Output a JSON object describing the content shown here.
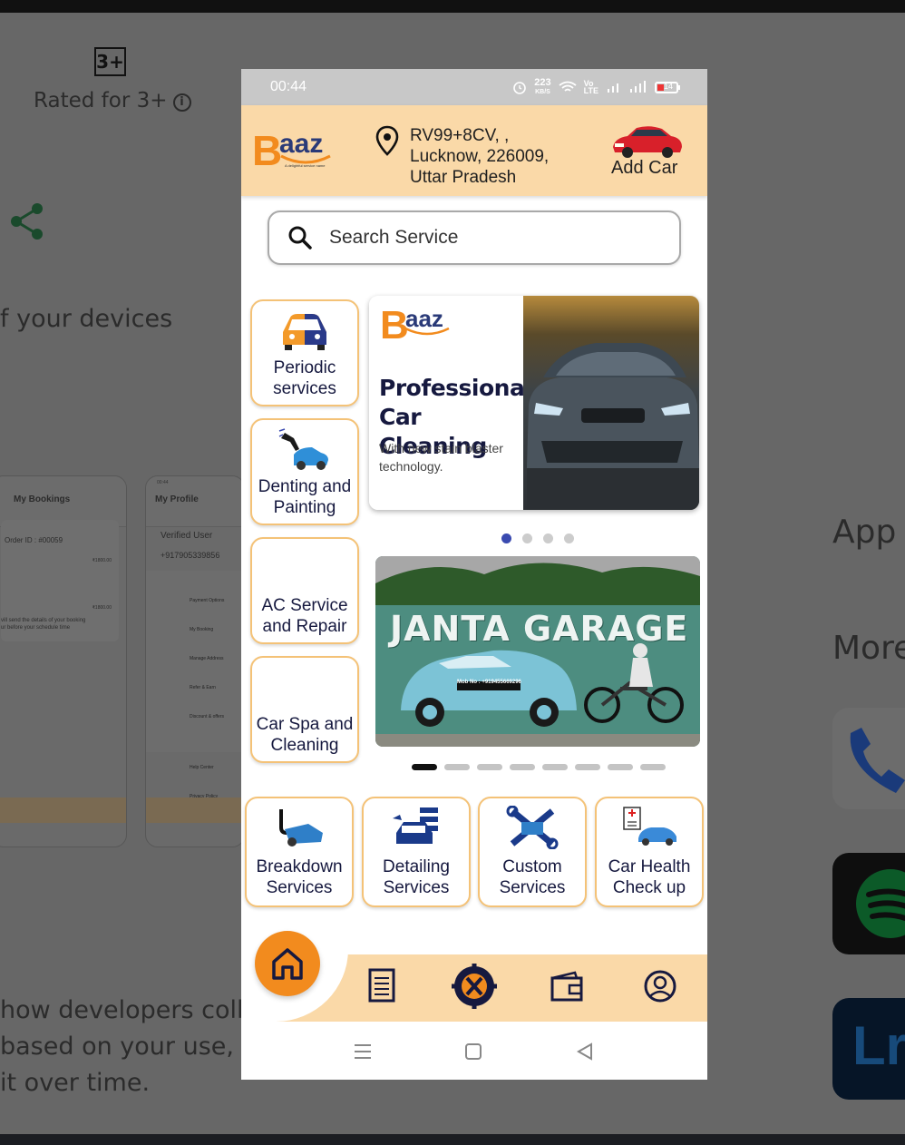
{
  "background": {
    "rating_badge": "3+",
    "rated_text": "Rated for 3+",
    "devices_text": "f your devices",
    "privacy_lines": [
      "how developers colle",
      "based on your use, reg",
      "it over time."
    ],
    "side_titles": [
      "App s",
      "More"
    ],
    "thumb_left": {
      "title": "My Bookings",
      "order": "Order ID : #00059",
      "amount1": "₹1800.00",
      "amount2": "₹1800.00",
      "note1": "vill send the details of your booking",
      "note2": "ur before your schedule time"
    },
    "thumb_right": {
      "time": "00:44",
      "title": "My Profile",
      "user": "Verified User",
      "phone": "+917905339856",
      "menu": [
        "Payment Options",
        "My Booking",
        "Manage Address",
        "Refer & Earn",
        "Discount & offers",
        "Help Center",
        "Privacy Policy"
      ]
    }
  },
  "status_bar": {
    "time": "00:44",
    "speed": "223",
    "speed_unit": "KB/S",
    "battery": "14"
  },
  "header": {
    "logo_b": "B",
    "logo_rest": "aaz",
    "logo_tagline": "A delightful service name",
    "address_lines": [
      "RV99+8CV, ,",
      "Lucknow, 226009,",
      "Uttar Pradesh"
    ],
    "add_car_label": "Add Car"
  },
  "search": {
    "placeholder": "Search Service"
  },
  "left_services": [
    {
      "label": "Periodic services"
    },
    {
      "label": "Denting and Painting"
    },
    {
      "label": "AC Service and Repair"
    },
    {
      "label": "Car Spa and Cleaning"
    }
  ],
  "promo_banner": {
    "logo_b": "B",
    "logo_rest": "aaz",
    "heading_line1": "Professional",
    "heading_line2": "Car Cleaning",
    "subtext_line1": "With new stain blaster",
    "subtext_line2": "technology.",
    "page_count": 4,
    "active_page": 0
  },
  "garage_banner": {
    "title": "JANTA GARAGE",
    "plate": "Mob No : +919455669296",
    "page_count": 8,
    "active_page": 0
  },
  "bottom_services": [
    {
      "line1": "Breakdown",
      "line2": "Services"
    },
    {
      "line1": "Detailing",
      "line2": "Services"
    },
    {
      "line1": "Custom",
      "line2": "Services"
    },
    {
      "line1": "Car Health",
      "line2": "Check up"
    }
  ],
  "nav": {
    "items": [
      "home-icon",
      "bookings-icon",
      "services-icon",
      "wallet-icon",
      "profile-icon"
    ],
    "active": "home"
  },
  "colors": {
    "accent_orange": "#f28b1e",
    "header_bg": "#fad9a8",
    "navy": "#16193f",
    "card_border": "#f4c277"
  }
}
